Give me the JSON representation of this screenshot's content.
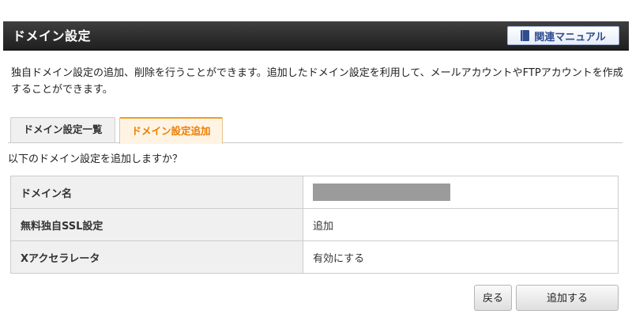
{
  "header": {
    "title": "ドメイン設定",
    "manual_label": "関連マニュアル"
  },
  "description": "独自ドメイン設定の追加、削除を行うことができます。追加したドメイン設定を利用して、メールアカウントやFTPアカウントを作成することができます。",
  "tabs": [
    {
      "label": "ドメイン設定一覧",
      "active": false
    },
    {
      "label": "ドメイン設定追加",
      "active": true
    }
  ],
  "question": "以下のドメイン設定を追加しますか？",
  "settings": {
    "rows": [
      {
        "key": "ドメイン名",
        "value": ""
      },
      {
        "key": "無料独自SSL設定",
        "value": "追加"
      },
      {
        "key": "Xアクセラレータ",
        "value": "有効にする"
      }
    ]
  },
  "buttons": {
    "back": "戻る",
    "submit": "追加する"
  },
  "colors": {
    "header_bg": "#2b2b2b",
    "active_tab_text": "#ee7d00",
    "active_tab_bg": "#fff4e3",
    "manual_text": "#2e4c8f"
  }
}
